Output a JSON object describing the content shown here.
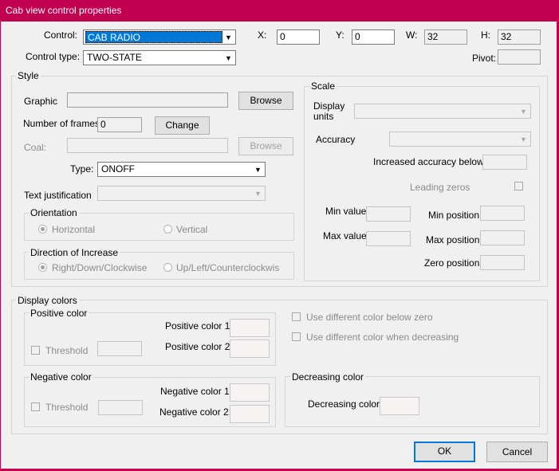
{
  "window": {
    "title": "Cab view control properties"
  },
  "top": {
    "control_label": "Control:",
    "control_value": "CAB RADIO",
    "control_type_label": "Control type:",
    "control_type_value": "TWO-STATE",
    "x_label": "X:",
    "x_value": "0",
    "y_label": "Y:",
    "y_value": "0",
    "w_label": "W:",
    "w_value": "32",
    "h_label": "H:",
    "h_value": "32",
    "pivot_label": "Pivot:",
    "pivot_value": ""
  },
  "style": {
    "legend": "Style",
    "graphic_label": "Graphic",
    "browse_label": "Browse",
    "frames_label": "Number of frames:",
    "frames_value": "0",
    "change_label": "Change",
    "coal_label": "Coal:",
    "coal_browse_label": "Browse",
    "type_label": "Type:",
    "type_value": "ONOFF",
    "justification_label": "Text justification",
    "orientation": {
      "legend": "Orientation",
      "horizontal": "Horizontal",
      "vertical": "Vertical"
    },
    "direction": {
      "legend": "Direction of Increase",
      "option1": "Right/Down/Clockwise",
      "option2": "Up/Left/Counterclockwis"
    }
  },
  "scale": {
    "legend": "Scale",
    "display_units_label_1": "Display",
    "display_units_label_2": "units",
    "accuracy_label": "Accuracy",
    "increased_accuracy_label": "Increased accuracy below:",
    "leading_zeros_label": "Leading zeros",
    "min_value_label": "Min value",
    "max_value_label": "Max value",
    "min_position_label": "Min position",
    "max_position_label": "Max position",
    "zero_position_label": "Zero position"
  },
  "display_colors": {
    "legend": "Display colors",
    "positive": {
      "legend": "Positive color",
      "color1_label": "Positive color 1:",
      "color2_label": "Positive color 2:",
      "threshold_label": "Threshold"
    },
    "negative": {
      "legend": "Negative color",
      "color1_label": "Negative color 1:",
      "color2_label": "Negative color 2:",
      "threshold_label": "Threshold"
    },
    "below_zero_label": "Use different color below zero",
    "when_decreasing_label": "Use different color when decreasing",
    "decreasing": {
      "legend": "Decreasing color",
      "label": "Decreasing color:"
    }
  },
  "footer": {
    "ok_label": "OK",
    "cancel_label": "Cancel"
  },
  "colors": {
    "titlebar": "#c1004f",
    "selection": "#0078d7"
  }
}
